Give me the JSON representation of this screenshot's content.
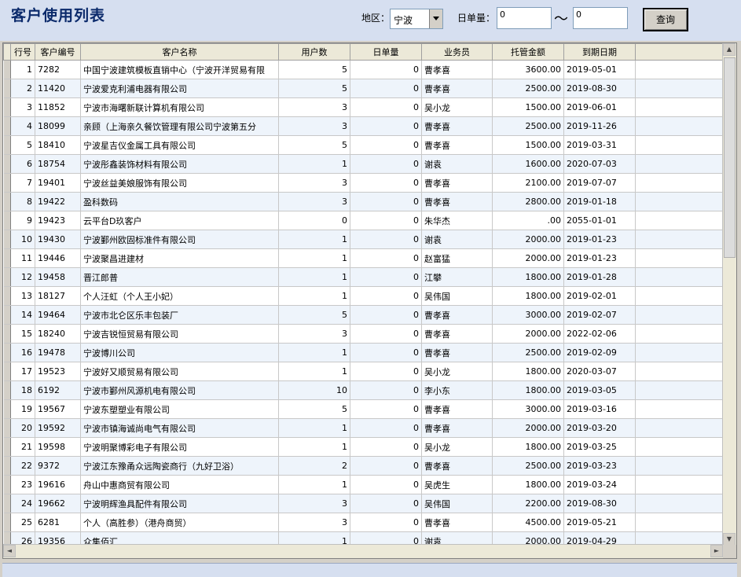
{
  "header": {
    "title": "客户使用列表",
    "region_label": "地区：",
    "region_value": "宁波",
    "daily_label": "日单量：",
    "daily_from": "0",
    "daily_to": "0",
    "tilde": "～",
    "query_button": "查询"
  },
  "columns": [
    "行号",
    "客户编号",
    "客户名称",
    "用户数",
    "日单量",
    "业务员",
    "托管金额",
    "到期日期"
  ],
  "rows": [
    [
      "1",
      "7282",
      "中国宁波建筑模板直销中心（宁波开洋贸易有限",
      "5",
      "0",
      "曹孝喜",
      "3600.00",
      "2019-05-01"
    ],
    [
      "2",
      "11420",
      "宁波爱克利浦电器有限公司",
      "5",
      "0",
      "曹孝喜",
      "2500.00",
      "2019-08-30"
    ],
    [
      "3",
      "11852",
      "宁波市海曙新联计算机有限公司",
      "3",
      "0",
      "吴小龙",
      "1500.00",
      "2019-06-01"
    ],
    [
      "4",
      "18099",
      "亲顾（上海亲久餐饮管理有限公司宁波第五分",
      "3",
      "0",
      "曹孝喜",
      "2500.00",
      "2019-11-26"
    ],
    [
      "5",
      "18410",
      "宁波星吉仪金属工具有限公司",
      "5",
      "0",
      "曹孝喜",
      "1500.00",
      "2019-03-31"
    ],
    [
      "6",
      "18754",
      "宁波彤鑫装饰材料有限公司",
      "1",
      "0",
      "谢袁",
      "1600.00",
      "2020-07-03"
    ],
    [
      "7",
      "19401",
      "宁波丝益美娘服饰有限公司",
      "3",
      "0",
      "曹孝喜",
      "2100.00",
      "2019-07-07"
    ],
    [
      "8",
      "19422",
      "盈科数码",
      "3",
      "0",
      "曹孝喜",
      "2800.00",
      "2019-01-18"
    ],
    [
      "9",
      "19423",
      "云平台D玖客户",
      "0",
      "0",
      "朱华杰",
      ".00",
      "2055-01-01"
    ],
    [
      "10",
      "19430",
      "宁波鄞州欧固标准件有限公司",
      "1",
      "0",
      "谢袁",
      "2000.00",
      "2019-01-23"
    ],
    [
      "11",
      "19446",
      "宁波聚昌进建材",
      "1",
      "0",
      "赵富猛",
      "2000.00",
      "2019-01-23"
    ],
    [
      "12",
      "19458",
      "晋江郎普",
      "1",
      "0",
      "江攀",
      "1800.00",
      "2019-01-28"
    ],
    [
      "13",
      "18127",
      "个人汪虹（个人王小妃）",
      "1",
      "0",
      "吴伟国",
      "1800.00",
      "2019-02-01"
    ],
    [
      "14",
      "19464",
      "宁波市北仑区乐丰包装厂",
      "5",
      "0",
      "曹孝喜",
      "3000.00",
      "2019-02-07"
    ],
    [
      "15",
      "18240",
      "宁波吉锐恒贸易有限公司",
      "3",
      "0",
      "曹孝喜",
      "2000.00",
      "2022-02-06"
    ],
    [
      "16",
      "19478",
      "宁波博川公司",
      "1",
      "0",
      "曹孝喜",
      "2500.00",
      "2019-02-09"
    ],
    [
      "17",
      "19523",
      "宁波好又顺贸易有限公司",
      "1",
      "0",
      "吴小龙",
      "1800.00",
      "2020-03-07"
    ],
    [
      "18",
      "6192",
      "宁波市鄞州风源机电有限公司",
      "10",
      "0",
      "李小东",
      "1800.00",
      "2019-03-05"
    ],
    [
      "19",
      "19567",
      "宁波东塑塑业有限公司",
      "5",
      "0",
      "曹孝喜",
      "3000.00",
      "2019-03-16"
    ],
    [
      "20",
      "19592",
      "宁波市镇海诚尚电气有限公司",
      "1",
      "0",
      "曹孝喜",
      "2000.00",
      "2019-03-20"
    ],
    [
      "21",
      "19598",
      "宁波明聚博彩电子有限公司",
      "1",
      "0",
      "吴小龙",
      "1800.00",
      "2019-03-25"
    ],
    [
      "22",
      "9372",
      "宁波江东豫甬众远陶瓷商行（九好卫浴）",
      "2",
      "0",
      "曹孝喜",
      "2500.00",
      "2019-03-23"
    ],
    [
      "23",
      "19616",
      "舟山中惠商贸有限公司",
      "1",
      "0",
      "吴虎生",
      "1800.00",
      "2019-03-24"
    ],
    [
      "24",
      "19662",
      "宁波明辉渔具配件有限公司",
      "3",
      "0",
      "吴伟国",
      "2200.00",
      "2019-08-30"
    ],
    [
      "25",
      "6281",
      "个人（高胜参）（港舟商贸）",
      "3",
      "0",
      "曹孝喜",
      "4500.00",
      "2019-05-21"
    ],
    [
      "26",
      "19356",
      "众集佰汇",
      "1",
      "0",
      "谢袁",
      "2000.00",
      "2019-04-29"
    ]
  ],
  "scrollbar": {
    "up": "▲",
    "down": "▼",
    "left": "◄",
    "right": "►"
  }
}
